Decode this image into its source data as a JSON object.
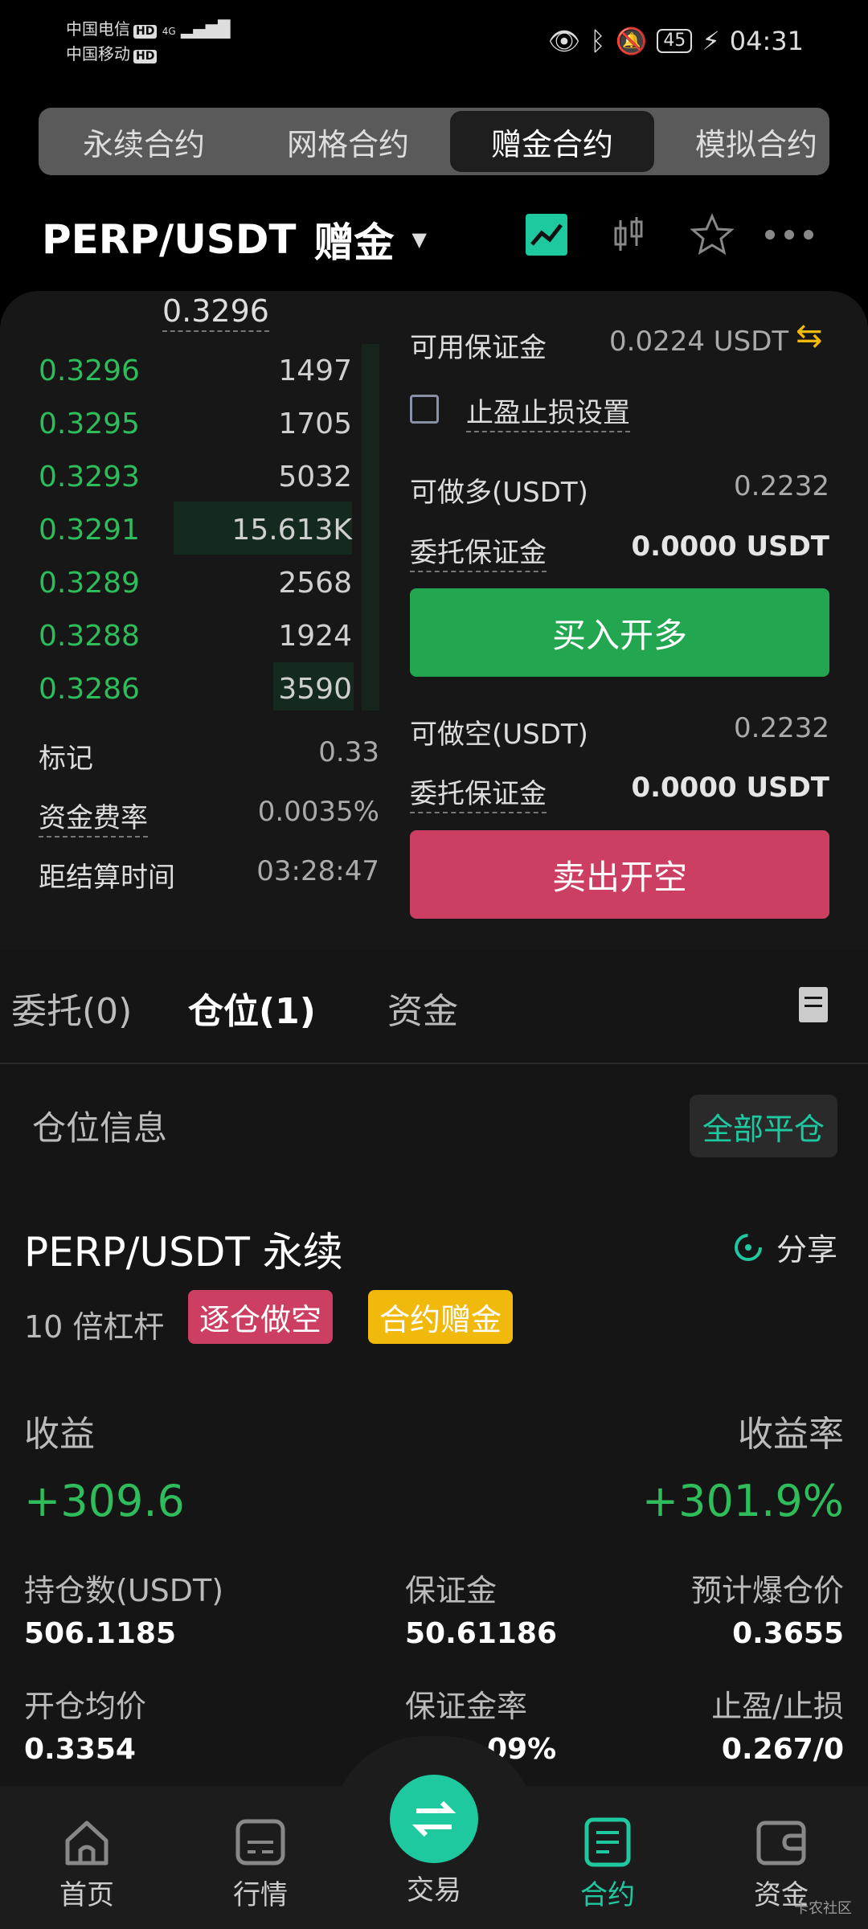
{
  "status_bar": {
    "carrier1": "中国电信",
    "carrier2": "中国移动",
    "hd": "HD",
    "net": "4G",
    "battery": "45",
    "time": "04:31"
  },
  "tabs": [
    {
      "label": "永续合约"
    },
    {
      "label": "网格合约"
    },
    {
      "label": "赠金合约"
    },
    {
      "label": "模拟合约"
    }
  ],
  "header": {
    "pair": "PERP/USDT",
    "badge": "赠金",
    "icons": [
      "chart-icon",
      "candlestick-icon",
      "star-icon",
      "more-icon"
    ]
  },
  "orderbook": {
    "top_price": "0.3296",
    "rows": [
      {
        "price": "0.3296",
        "qty": "1497"
      },
      {
        "price": "0.3295",
        "qty": "1705"
      },
      {
        "price": "0.3293",
        "qty": "5032"
      },
      {
        "price": "0.3291",
        "qty": "15.613K"
      },
      {
        "price": "0.3289",
        "qty": "2568"
      },
      {
        "price": "0.3288",
        "qty": "1924"
      },
      {
        "price": "0.3286",
        "qty": "3590"
      }
    ],
    "mark_label": "标记",
    "mark_value": "0.33",
    "funding_label": "资金费率",
    "funding_value": "0.0035%",
    "settle_label": "距结算时间",
    "settle_value": "03:28:47"
  },
  "order_form": {
    "available_label": "可用保证金",
    "available_value": "0.0224 USDT",
    "tpsl_label": "止盈止损设置",
    "long_label": "可做多(USDT)",
    "long_value": "0.2232",
    "long_margin_label": "委托保证金",
    "long_margin_value": "0.0000 USDT",
    "buy_button": "买入开多",
    "short_label": "可做空(USDT)",
    "short_value": "0.2232",
    "short_margin_label": "委托保证金",
    "short_margin_value": "0.0000 USDT",
    "sell_button": "卖出开空"
  },
  "position_tabs": [
    {
      "label": "委托(0)"
    },
    {
      "label": "仓位(1)"
    },
    {
      "label": "资金"
    }
  ],
  "position": {
    "section_title": "仓位信息",
    "close_all": "全部平仓",
    "title": "PERP/USDT 永续",
    "share": "分享",
    "leverage": "10 倍杠杆",
    "tag_short": "逐仓做空",
    "tag_bonus": "合约赠金",
    "pnl_label": "收益",
    "pnl_value": "+309.6",
    "roe_label": "收益率",
    "roe_value": "+301.9%",
    "size_label": "持仓数(USDT)",
    "size_value": "506.1185",
    "margin_label": "保证金",
    "margin_value": "50.61186",
    "liq_label": "预计爆仓价",
    "liq_value": "0.3655",
    "entry_label": "开仓均价",
    "entry_value": "0.3354",
    "margin_ratio_label": "保证金率",
    "margin_ratio_value": "…09%",
    "tpsl_label": "止盈/止损",
    "tpsl_value": "0.267/0"
  },
  "nav": [
    {
      "label": "首页"
    },
    {
      "label": "行情"
    },
    {
      "label": "交易"
    },
    {
      "label": "合约"
    },
    {
      "label": "资金"
    }
  ],
  "watermark": "卡农社区",
  "colors": {
    "green": "#2ebd5a",
    "red": "#cc3e62",
    "yellow": "#f0b90b",
    "teal": "#1fc9a0"
  }
}
